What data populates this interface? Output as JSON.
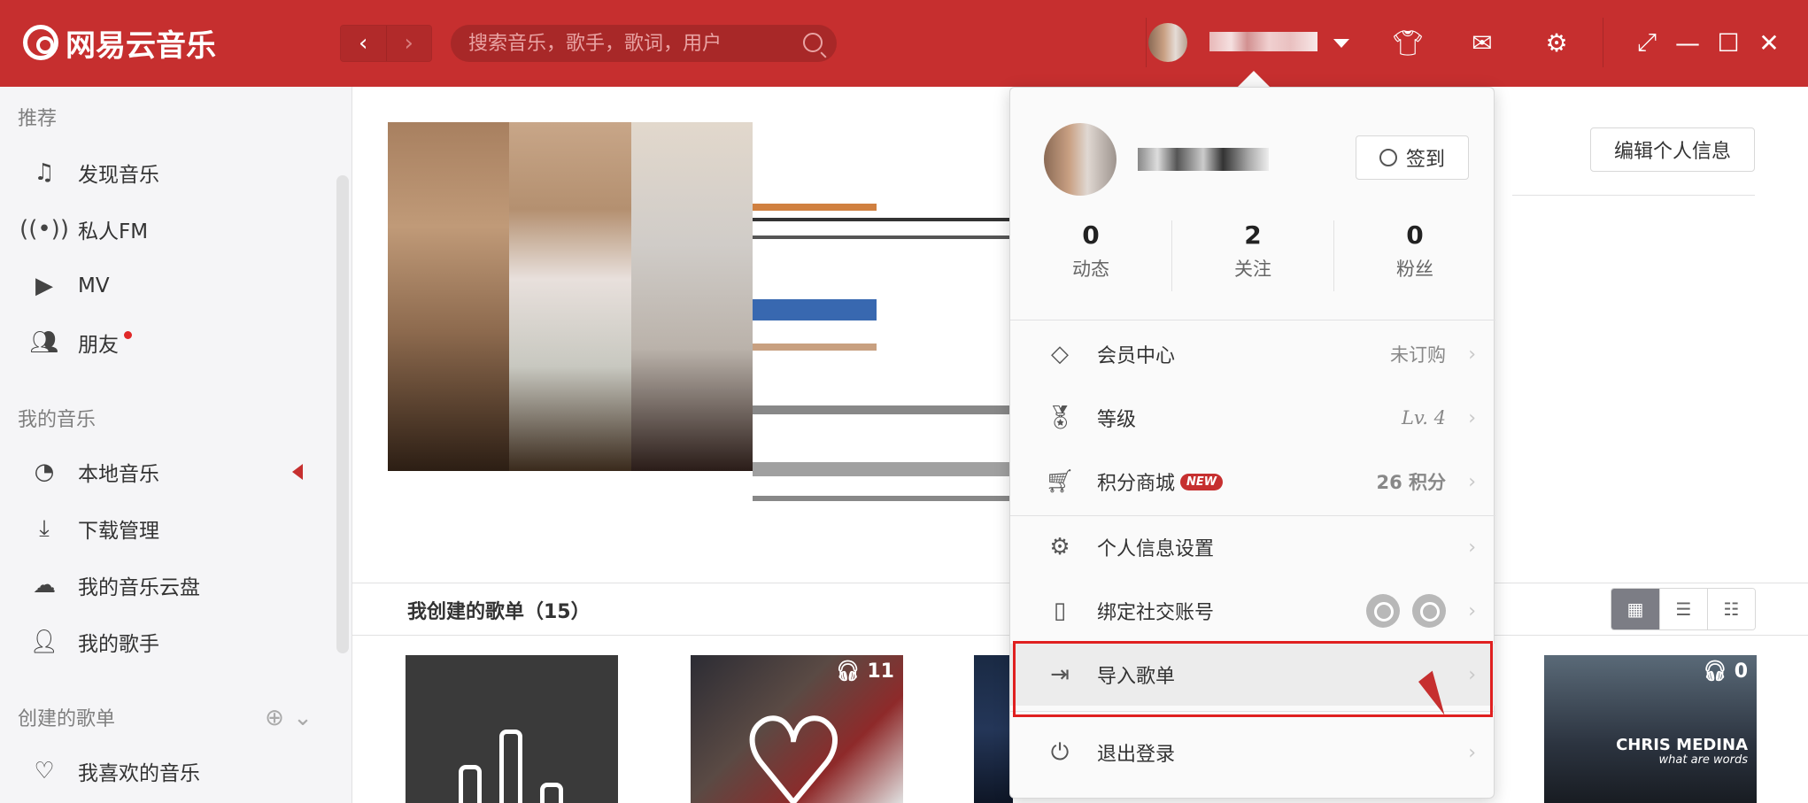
{
  "app": {
    "title": "网易云音乐"
  },
  "search": {
    "placeholder": "搜索音乐，歌手，歌词，用户"
  },
  "nav": {
    "back": "‹",
    "forward": "›"
  },
  "sidebar": {
    "sections": [
      {
        "title": "推荐"
      },
      {
        "title": "我的音乐"
      },
      {
        "title": "创建的歌单"
      }
    ],
    "recommend": [
      "发现音乐",
      "私人FM",
      "MV",
      "朋友"
    ],
    "mymusic": [
      "本地音乐",
      "下载管理",
      "我的音乐云盘",
      "我的歌手"
    ],
    "playlists": [
      "我喜欢的音乐"
    ]
  },
  "main": {
    "edit_profile": "编辑个人信息",
    "created_playlists": "我创建的歌单（15）",
    "playlist_cards": [
      {
        "count": ""
      },
      {
        "count": "11"
      },
      {
        "count": ""
      },
      {
        "count": "0",
        "artist": "CHRIS MEDINA",
        "subtitle": "what are words"
      }
    ]
  },
  "popup": {
    "signin": "签到",
    "stats": [
      {
        "num": "0",
        "label": "动态"
      },
      {
        "num": "2",
        "label": "关注"
      },
      {
        "num": "0",
        "label": "粉丝"
      }
    ],
    "menu": {
      "vip": {
        "label": "会员中心",
        "value": "未订购"
      },
      "level": {
        "label": "等级",
        "value": "Lv. 4"
      },
      "shop": {
        "label": "积分商城",
        "badge": "NEW",
        "value": "26 积分"
      },
      "settings": {
        "label": "个人信息设置"
      },
      "bind": {
        "label": "绑定社交账号"
      },
      "import": {
        "label": "导入歌单"
      },
      "logout": {
        "label": "退出登录"
      }
    },
    "chevron": "›"
  },
  "colors": {
    "brand": "#c62f2f",
    "highlight_box": "#e02020"
  }
}
